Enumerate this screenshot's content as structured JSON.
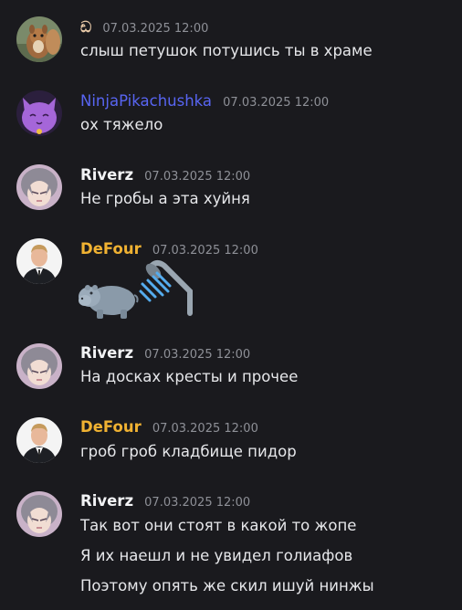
{
  "colors": {
    "background": "#1a1a1e",
    "text": "#e6e7ea",
    "timestamp": "#8e9097",
    "username_default": "#f2f3f5",
    "username_ninja": "#5865f2",
    "username_defour": "#f0b232"
  },
  "messages": [
    {
      "author": "ඩ",
      "avatar": "squirrel-avatar",
      "timestamp": "07.03.2025 12:00",
      "lines": [
        "слыш петушок потушись ты в храме"
      ]
    },
    {
      "author": "NinjaPikachushka",
      "avatar": "purple-cat-avatar",
      "timestamp": "07.03.2025 12:00",
      "lines": [
        "ох тяжело"
      ]
    },
    {
      "author": "Riverz",
      "avatar": "anime-avatar",
      "timestamp": "07.03.2025 12:00",
      "lines": [
        "Не гробы а эта хуйня"
      ]
    },
    {
      "author": "DeFour",
      "avatar": "suit-man-avatar",
      "timestamp": "07.03.2025 12:00",
      "emojis": [
        "hippopotamus-emoji",
        "shower-emoji"
      ]
    },
    {
      "author": "Riverz",
      "avatar": "anime-avatar",
      "timestamp": "07.03.2025 12:00",
      "lines": [
        "На досках кресты и прочее"
      ]
    },
    {
      "author": "DeFour",
      "avatar": "suit-man-avatar",
      "timestamp": "07.03.2025 12:00",
      "lines": [
        "гроб гроб кладбище пидор"
      ]
    },
    {
      "author": "Riverz",
      "avatar": "anime-avatar",
      "timestamp": "07.03.2025 12:00",
      "lines": [
        "Так вот они стоят в какой то жопе",
        "Я их наешл и не увидел голиафов",
        "Поэтому опять же скил ишуй нинжы"
      ]
    }
  ]
}
